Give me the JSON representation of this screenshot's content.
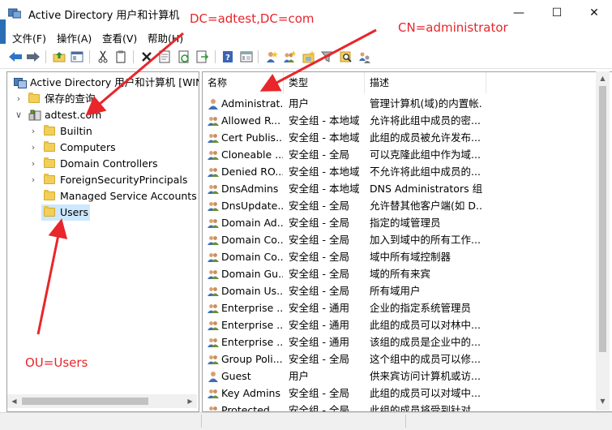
{
  "window": {
    "title": "Active Directory 用户和计算机",
    "minimize": "—",
    "maximize": "☐",
    "close": "✕"
  },
  "menu": [
    {
      "label": "文件(F)"
    },
    {
      "label": "操作(A)"
    },
    {
      "label": "查看(V)"
    },
    {
      "label": "帮助(H)"
    }
  ],
  "toolbar_icons": [
    "back-arrow-icon",
    "forward-arrow-icon",
    "up-folder-icon",
    "show-hide-tree-icon",
    "cut-icon",
    "copy-icon",
    "delete-icon",
    "properties-icon",
    "refresh-icon",
    "export-list-icon",
    "help-icon",
    "view-icon",
    "new-user-icon",
    "new-group-icon",
    "new-ou-icon",
    "filter-icon",
    "find-icon",
    "add-to-group-icon"
  ],
  "tree": {
    "root": "Active Directory 用户和计算机 [WIN-",
    "saved_queries": "保存的查询",
    "domain": "adtest.com",
    "containers": [
      {
        "label": "Builtin"
      },
      {
        "label": "Computers"
      },
      {
        "label": "Domain Controllers"
      },
      {
        "label": "ForeignSecurityPrincipals"
      },
      {
        "label": "Managed Service Accounts"
      },
      {
        "label": "Users"
      }
    ]
  },
  "columns": {
    "name": "名称",
    "type": "类型",
    "description": "描述"
  },
  "rows": [
    {
      "name": "Administrat...",
      "type": "用户",
      "description": "管理计算机(域)的内置帐...",
      "icon": "user-icon"
    },
    {
      "name": "Allowed R...",
      "type": "安全组 - 本地域",
      "description": "允许将此组中成员的密...",
      "icon": "group-icon"
    },
    {
      "name": "Cert Publis...",
      "type": "安全组 - 本地域",
      "description": "此组的成员被允许发布...",
      "icon": "group-icon"
    },
    {
      "name": "Cloneable ...",
      "type": "安全组 - 全局",
      "description": "可以克隆此组中作为域...",
      "icon": "group-icon"
    },
    {
      "name": "Denied RO...",
      "type": "安全组 - 本地域",
      "description": "不允许将此组中成员的...",
      "icon": "group-icon"
    },
    {
      "name": "DnsAdmins",
      "type": "安全组 - 本地域",
      "description": "DNS Administrators 组",
      "icon": "group-icon"
    },
    {
      "name": "DnsUpdate...",
      "type": "安全组 - 全局",
      "description": "允许替其他客户端(如 D...",
      "icon": "group-icon"
    },
    {
      "name": "Domain Ad...",
      "type": "安全组 - 全局",
      "description": "指定的域管理员",
      "icon": "group-icon"
    },
    {
      "name": "Domain Co...",
      "type": "安全组 - 全局",
      "description": "加入到域中的所有工作...",
      "icon": "group-icon"
    },
    {
      "name": "Domain Co...",
      "type": "安全组 - 全局",
      "description": "域中所有域控制器",
      "icon": "group-icon"
    },
    {
      "name": "Domain Gu...",
      "type": "安全组 - 全局",
      "description": "域的所有来宾",
      "icon": "group-icon"
    },
    {
      "name": "Domain Us...",
      "type": "安全组 - 全局",
      "description": "所有域用户",
      "icon": "group-icon"
    },
    {
      "name": "Enterprise ...",
      "type": "安全组 - 通用",
      "description": "企业的指定系统管理员",
      "icon": "group-icon"
    },
    {
      "name": "Enterprise ...",
      "type": "安全组 - 通用",
      "description": "此组的成员可以对林中...",
      "icon": "group-icon"
    },
    {
      "name": "Enterprise ...",
      "type": "安全组 - 通用",
      "description": "该组的成员是企业中的...",
      "icon": "group-icon"
    },
    {
      "name": "Group Poli...",
      "type": "安全组 - 全局",
      "description": "这个组中的成员可以修...",
      "icon": "group-icon"
    },
    {
      "name": "Guest",
      "type": "用户",
      "description": "供来宾访问计算机或访...",
      "icon": "user-icon"
    },
    {
      "name": "Key Admins",
      "type": "安全组 - 全局",
      "description": "此组的成员可以对域中...",
      "icon": "group-icon"
    },
    {
      "name": "Protected ...",
      "type": "安全组 - 全局",
      "description": "此组的成员将受到针对...",
      "icon": "group-icon"
    }
  ],
  "annotations": {
    "dc": "DC=adtest,DC=com",
    "cn": "CN=administrator",
    "ou": "OU=Users"
  },
  "colors": {
    "annotation": "#e8262b",
    "selection": "#cce8ff",
    "folder": "#f2cf5b"
  }
}
